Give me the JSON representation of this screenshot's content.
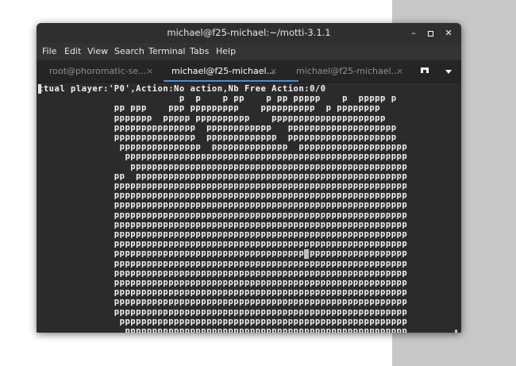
{
  "window": {
    "title": "michael@f25-michael:~/motti-3.1.1"
  },
  "menubar": [
    "File",
    "Edit",
    "View",
    "Search",
    "Terminal",
    "Tabs",
    "Help"
  ],
  "tabs": [
    {
      "label": "root@phoromatic-se...",
      "close": "×",
      "active": false
    },
    {
      "label": "michael@f25-michael...",
      "close": "×",
      "active": true
    },
    {
      "label": "michael@f25-michael...",
      "close": "×",
      "active": false
    }
  ],
  "terminal": {
    "lines": [
      "ctual player:'P0',Action:No action,Nb Free Action:0/0",
      "                          p  p    p pp    p pp ppppp    p  ppppp p",
      "              pp ppp    ppp ppppppppp    pppppppppp  p pppppppp",
      "              ppppppp  ppppp pppppppppp    ppppppppppppppppppppp",
      "              ppppppppppppppp  pppppppppppp   pppppppppppppppppppp",
      "              ppppppppppppppp  ppppppppppppp  pppppppppppppppppppp",
      "               ppppppppppppppp  pppppppppppppp  pppppppppppppppppppp",
      "                pppppppppppppppppppppppppppppppppppppppppppppppppppp",
      "                 ppppppppppppppppppppppppppppppppppppppppppppppppppp",
      "              pp  pppppppppppppppppppppppppppppppppppppppppppppppppp",
      "              pppppppppppppppppppppppppppppppppppppppppppppppppppppp",
      "              pppppppppppppppppppppppppppppppppppppppppppppppppppppp",
      "              pppppppppppppppppppppppppppppppppppppppppppppppppppppp",
      "              pppppppppppppppppppppppppppppppppppppppppppppppppppppp",
      "              pppppppppppppppppppppppppppppppppppppppppppppppppppppp",
      "              pppppppppppppppppppppppppppppppppppppppppppppppppppppp",
      "              pppppppppppppppppppppppppppppppppppppppppppppppppppppp",
      "              pppppppppppppppppppppppppppppppppppppppppppppppppppppp",
      "              pppppppppppppppppppppppppppppppppppppppppppppppppppppp",
      "              pppppppppppppppppppppppppppppppppppppppppppppppppppppp",
      "              pppppppppppppppppppppppppppppppppppppppppppppppppppppp",
      "              pppppppppppppppppppppppppppppppppppppppppppppppppppppp",
      "              pppppppppppppppppppppppppppppppppppppppppppppppppppppp",
      "              pppppppppppppppppppppppppppppppppppppppppppppppppppppp",
      "               ppppppppppppppppppppppppppppppppppppppppppppppppppppp",
      "                pppppppppppppppppppppppppppppppppppppppppppppppppppp"
    ]
  },
  "icons": {
    "minimize": "minimize-icon",
    "maximize": "maximize-icon",
    "close": "close-icon",
    "new_tab": "new-tab-icon",
    "tab_menu": "chevron-down-icon"
  },
  "colors": {
    "terminal_bg": "#2b2b2b",
    "terminal_fg": "#f2f2f2",
    "active_tab_underline": "#4a90d9",
    "desktop_right": "#c8c8c8"
  }
}
